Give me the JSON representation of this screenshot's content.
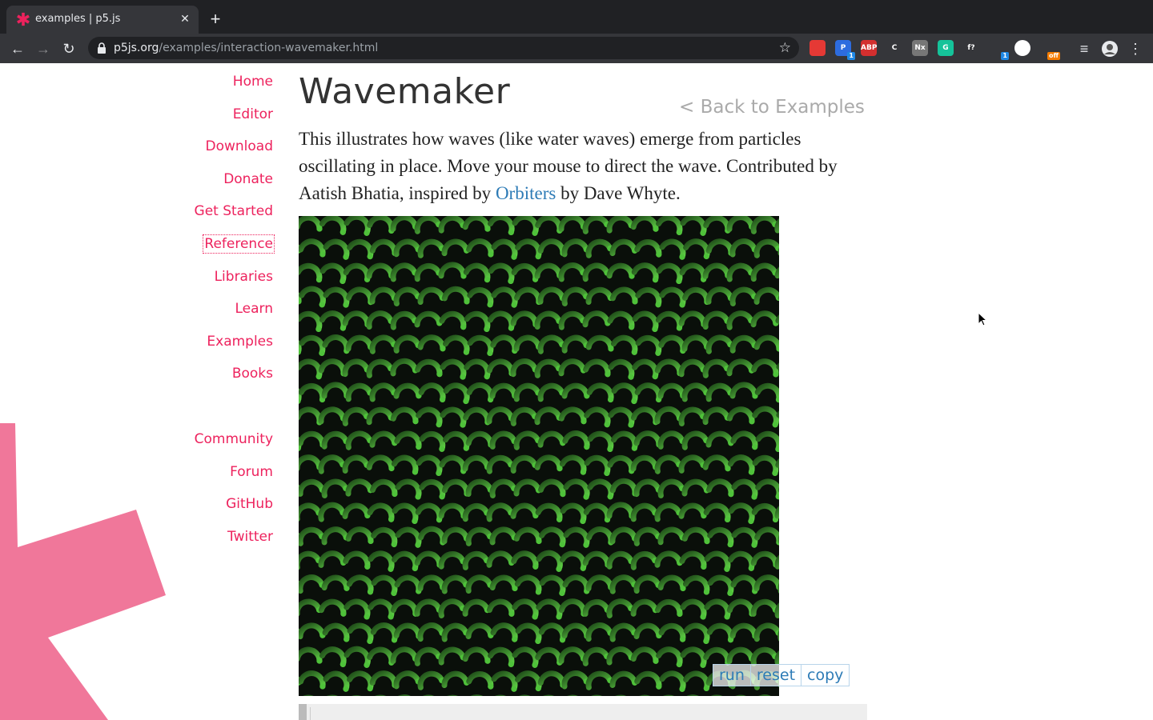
{
  "browser": {
    "tab_title": "examples | p5.js",
    "url_host": "p5js.org",
    "url_path": "/examples/interaction-wavemaker.html",
    "extensions": [
      {
        "name": "ad-shield-icon",
        "label": "",
        "color": "#e53935",
        "badge": ""
      },
      {
        "name": "p-ext-icon",
        "label": "P",
        "color": "#2d6cdf",
        "badge": "1"
      },
      {
        "name": "adblock-plus-icon",
        "label": "ABP",
        "color": "#d32f2f",
        "badge": ""
      },
      {
        "name": "cc-ext-icon",
        "label": "C",
        "color": "#35363a",
        "badge": ""
      },
      {
        "name": "nx-ext-icon",
        "label": "Nx",
        "color": "#777777",
        "badge": ""
      },
      {
        "name": "grammarly-icon",
        "label": "G",
        "color": "#15c39a",
        "badge": ""
      },
      {
        "name": "fonts-ext-icon",
        "label": "f?",
        "color": "#35363a",
        "badge": ""
      },
      {
        "name": "moon-ext-icon",
        "label": "",
        "color": "#35363a",
        "badge": "1"
      },
      {
        "name": "dark-mode-icon",
        "label": "",
        "color": "#ffffff",
        "badge": ""
      },
      {
        "name": "home-ext-icon",
        "label": "",
        "color": "#35363a",
        "badge": "off"
      }
    ]
  },
  "nav": {
    "items": [
      "Home",
      "Editor",
      "Download",
      "Donate",
      "Get Started",
      "Reference",
      "Libraries",
      "Learn",
      "Examples",
      "Books"
    ],
    "community": [
      "Community",
      "Forum",
      "GitHub",
      "Twitter"
    ]
  },
  "page": {
    "title": "Wavemaker",
    "back_link": "< Back to Examples",
    "desc_part1": "This illustrates how waves (like water waves) emerge from particles oscillating in place. Move your mouse to direct the wave. Contributed by Aatish Bhatia, inspired by ",
    "desc_link": "Orbiters",
    "desc_part2": " by Dave Whyte.",
    "buttons": {
      "run": "run",
      "reset": "reset",
      "copy": "copy"
    }
  },
  "colors": {
    "brand": "#ed225d",
    "link": "#2d7bb6",
    "wave": "#4fc23a"
  }
}
